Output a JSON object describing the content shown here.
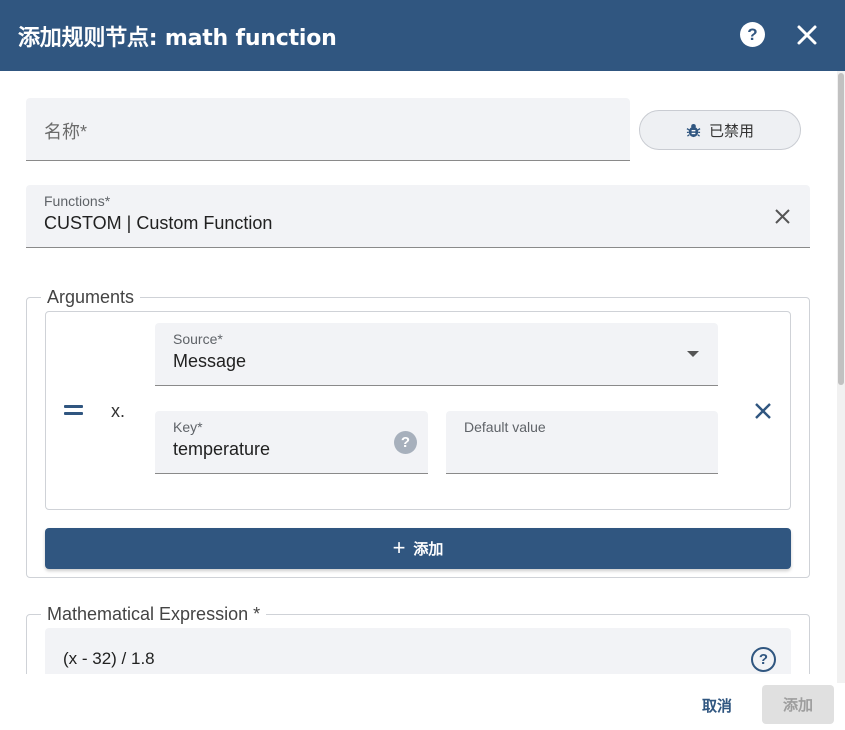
{
  "dialog": {
    "title": "添加规则节点: math function",
    "help_glyph": "?",
    "icons": {
      "help": "help-circle-icon",
      "close": "close-icon"
    }
  },
  "name_field": {
    "placeholder": "名称*"
  },
  "debug_toggle": {
    "label": "已禁用",
    "icon": "bug-icon"
  },
  "functions_field": {
    "label": "Functions*",
    "value": "CUSTOM | Custom Function",
    "clear_icon": "clear-icon"
  },
  "arguments": {
    "legend": "Arguments",
    "items": [
      {
        "prefix": "x.",
        "drag_icon": "drag-handle-icon",
        "source": {
          "label": "Source*",
          "value": "Message",
          "icon": "dropdown-arrow-icon"
        },
        "key": {
          "label": "Key*",
          "value": "temperature",
          "help_glyph": "?"
        },
        "default_value": {
          "label": "Default value",
          "value": ""
        },
        "remove_icon": "remove-icon"
      }
    ],
    "add_button": {
      "plus": "+",
      "label": "添加"
    }
  },
  "expression": {
    "legend": "Mathematical Expression *",
    "value": "(x - 32) / 1.8",
    "help_glyph": "?"
  },
  "footer": {
    "cancel_label": "取消",
    "submit_label": "添加"
  },
  "colors": {
    "primary": "#305680",
    "field_bg": "#f2f3f6",
    "disabled_bg": "#e0e0e0"
  }
}
